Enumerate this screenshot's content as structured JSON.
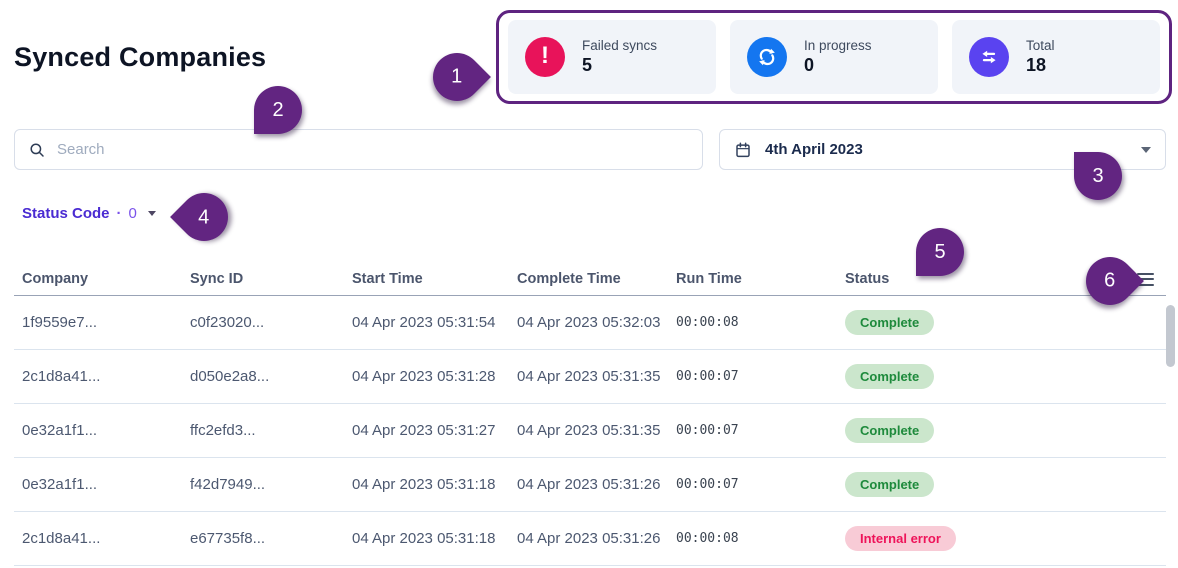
{
  "page": {
    "title": "Synced Companies"
  },
  "stats": {
    "cards": [
      {
        "label": "Failed syncs",
        "value": "5",
        "icon": "alert-icon",
        "color": "#e8135a"
      },
      {
        "label": "In progress",
        "value": "0",
        "icon": "sync-icon",
        "color": "#1476f0"
      },
      {
        "label": "Total",
        "value": "18",
        "icon": "transfer-icon",
        "color": "#5a43f0"
      }
    ]
  },
  "search": {
    "placeholder": "Search"
  },
  "date_picker": {
    "value": "4th April 2023"
  },
  "filters": {
    "status_code": {
      "label": "Status Code",
      "separator": "·",
      "value": "0"
    }
  },
  "table": {
    "columns": [
      "Company",
      "Sync ID",
      "Start Time",
      "Complete Time",
      "Run Time",
      "Status"
    ],
    "rows": [
      {
        "company": "1f9559e7...",
        "sync_id": "c0f23020...",
        "start_time": "04 Apr 2023  05:31:54",
        "complete_time": "04 Apr 2023  05:32:03",
        "run_time": "00:00:08",
        "status": "Complete",
        "status_type": "success"
      },
      {
        "company": "2c1d8a41...",
        "sync_id": "d050e2a8...",
        "start_time": "04 Apr 2023  05:31:28",
        "complete_time": "04 Apr 2023  05:31:35",
        "run_time": "00:00:07",
        "status": "Complete",
        "status_type": "success"
      },
      {
        "company": "0e32a1f1...",
        "sync_id": "ffc2efd3...",
        "start_time": "04 Apr 2023  05:31:27",
        "complete_time": "04 Apr 2023  05:31:35",
        "run_time": "00:00:07",
        "status": "Complete",
        "status_type": "success"
      },
      {
        "company": "0e32a1f1...",
        "sync_id": "f42d7949...",
        "start_time": "04 Apr 2023  05:31:18",
        "complete_time": "04 Apr 2023  05:31:26",
        "run_time": "00:00:07",
        "status": "Complete",
        "status_type": "success"
      },
      {
        "company": "2c1d8a41...",
        "sync_id": "e67735f8...",
        "start_time": "04 Apr 2023  05:31:18",
        "complete_time": "04 Apr 2023  05:31:26",
        "run_time": "00:00:08",
        "status": "Internal error",
        "status_type": "error"
      }
    ]
  },
  "annotations": {
    "badges": [
      "1",
      "2",
      "3",
      "4",
      "5",
      "6"
    ]
  },
  "colors": {
    "annotation_purple": "#622581",
    "failed_icon": "#e8135a",
    "progress_icon": "#1476f0",
    "total_icon": "#5a43f0",
    "pill_success_bg": "#cbe6cc",
    "pill_success_text": "#1e8a3c",
    "pill_error_bg": "#f8cbd6",
    "pill_error_text": "#ee145a",
    "filter_purple": "#4a2bd2"
  }
}
